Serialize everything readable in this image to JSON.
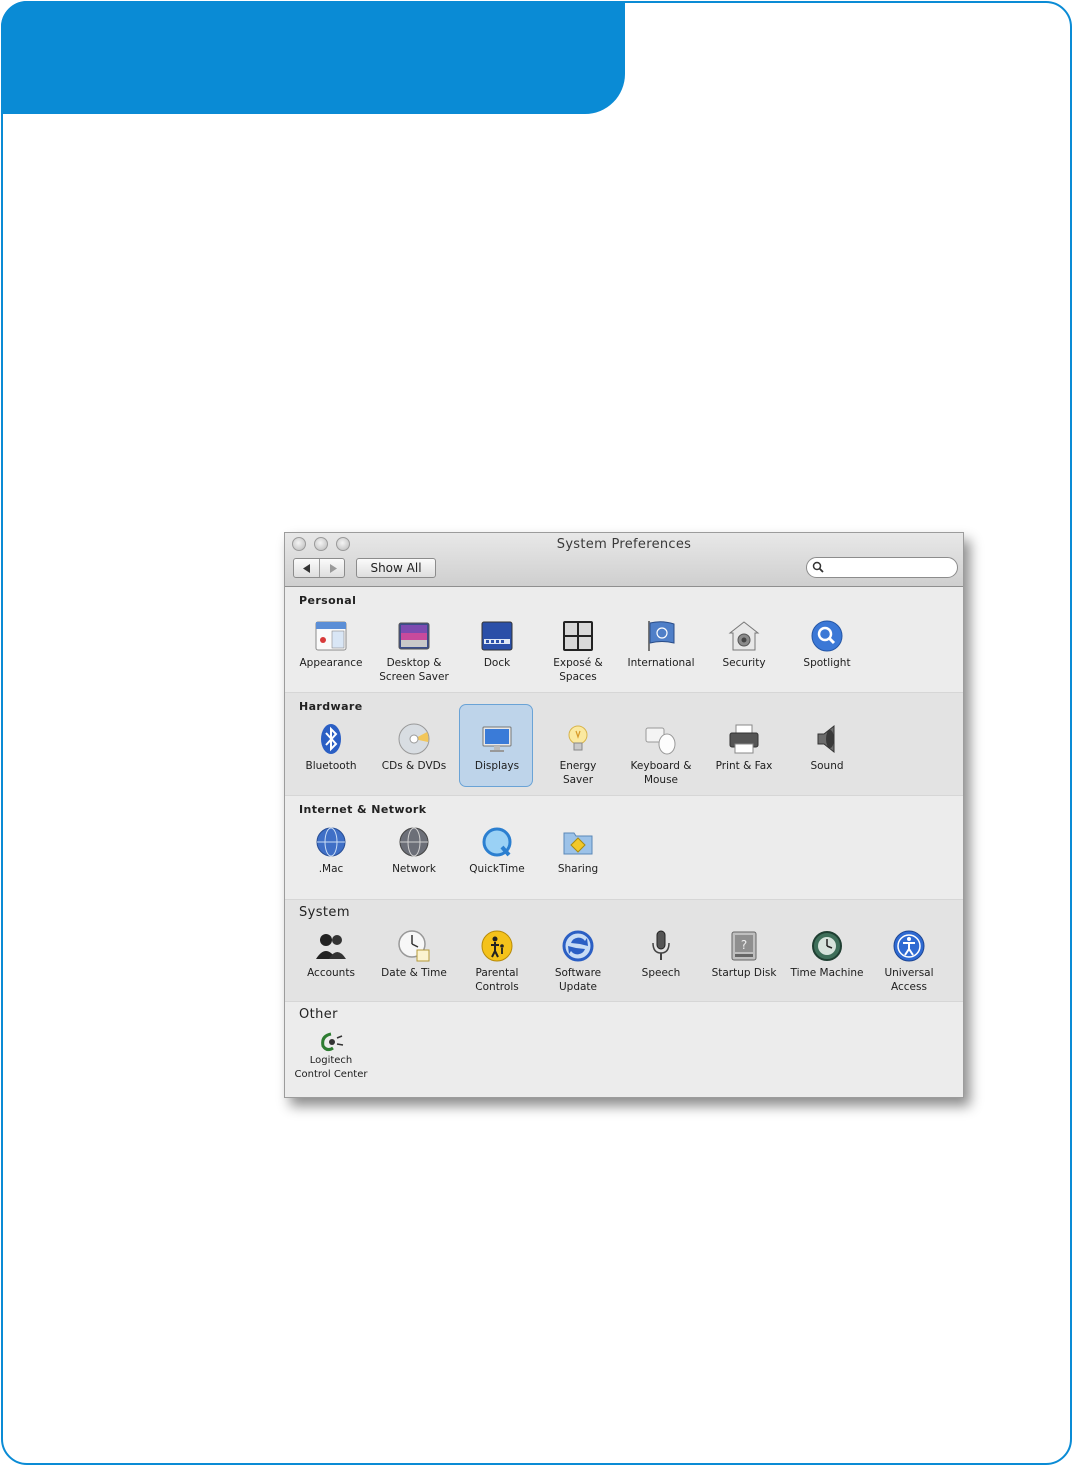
{
  "window": {
    "title": "System Preferences",
    "show_all": "Show All",
    "search_placeholder": ""
  },
  "sections": [
    {
      "title": "Personal",
      "items": [
        {
          "label": "Appearance",
          "icon": "appearance-icon"
        },
        {
          "label": "Desktop &\nScreen Saver",
          "icon": "desktop-icon"
        },
        {
          "label": "Dock",
          "icon": "dock-icon"
        },
        {
          "label": "Exposé &\nSpaces",
          "icon": "expose-icon"
        },
        {
          "label": "International",
          "icon": "international-icon"
        },
        {
          "label": "Security",
          "icon": "security-icon"
        },
        {
          "label": "Spotlight",
          "icon": "spotlight-icon"
        }
      ]
    },
    {
      "title": "Hardware",
      "items": [
        {
          "label": "Bluetooth",
          "icon": "bluetooth-icon"
        },
        {
          "label": "CDs & DVDs",
          "icon": "cd-icon"
        },
        {
          "label": "Displays",
          "icon": "display-icon",
          "selected": true
        },
        {
          "label": "Energy\nSaver",
          "icon": "lightbulb-icon"
        },
        {
          "label": "Keyboard &\nMouse",
          "icon": "keyboard-icon"
        },
        {
          "label": "Print & Fax",
          "icon": "printer-icon"
        },
        {
          "label": "Sound",
          "icon": "speaker-icon"
        }
      ]
    },
    {
      "title": "Internet & Network",
      "items": [
        {
          "label": ".Mac",
          "icon": "globe-icon"
        },
        {
          "label": "Network",
          "icon": "network-icon"
        },
        {
          "label": "QuickTime",
          "icon": "quicktime-icon"
        },
        {
          "label": "Sharing",
          "icon": "sharing-folder-icon"
        }
      ]
    },
    {
      "title": "System",
      "items": [
        {
          "label": "Accounts",
          "icon": "accounts-icon"
        },
        {
          "label": "Date & Time",
          "icon": "clock-icon"
        },
        {
          "label": "Parental\nControls",
          "icon": "parental-icon"
        },
        {
          "label": "Software\nUpdate",
          "icon": "update-icon"
        },
        {
          "label": "Speech",
          "icon": "microphone-icon"
        },
        {
          "label": "Startup Disk",
          "icon": "disk-icon"
        },
        {
          "label": "Time Machine",
          "icon": "time-machine-icon"
        },
        {
          "label": "Universal\nAccess",
          "icon": "accessibility-icon"
        }
      ]
    },
    {
      "title": "Other",
      "items": [
        {
          "label": "Logitech\nControl Center",
          "icon": "logitech-icon"
        }
      ]
    }
  ],
  "colors": {
    "brand_blue": "#0a8bd5",
    "selection": "#a0c8f0"
  }
}
